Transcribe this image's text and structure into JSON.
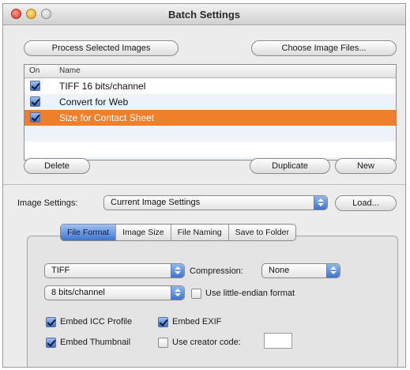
{
  "window": {
    "title": "Batch Settings"
  },
  "top_buttons": {
    "process": "Process Selected Images",
    "choose": "Choose Image Files..."
  },
  "list": {
    "headers": {
      "on": "On",
      "name": "Name"
    },
    "rows": [
      {
        "name": "TIFF 16 bits/channel",
        "checked": true
      },
      {
        "name": "Convert for Web",
        "checked": true
      },
      {
        "name": "Size for Contact Sheet",
        "checked": true,
        "selected": true
      }
    ]
  },
  "list_buttons": {
    "delete": "Delete",
    "duplicate": "Duplicate",
    "new": "New"
  },
  "image_settings": {
    "label": "Image Settings:",
    "value": "Current Image Settings",
    "load": "Load..."
  },
  "tabs": [
    "File Format",
    "Image Size",
    "File Naming",
    "Save to Folder"
  ],
  "active_tab": "File Format",
  "file_format": {
    "format_value": "TIFF",
    "compression_label": "Compression:",
    "compression_value": "None",
    "bits_value": "8 bits/channel",
    "little_endian_label": "Use little-endian format",
    "little_endian_checked": false,
    "embed_icc_label": "Embed ICC Profile",
    "embed_icc_checked": true,
    "embed_exif_label": "Embed EXIF",
    "embed_exif_checked": true,
    "embed_thumb_label": "Embed Thumbnail",
    "embed_thumb_checked": true,
    "creator_code_label": "Use creator code:",
    "creator_code_checked": false,
    "creator_code_value": ""
  },
  "colors": {
    "selection": "#f07f2b",
    "aqua_blue": "#3d74d2"
  }
}
